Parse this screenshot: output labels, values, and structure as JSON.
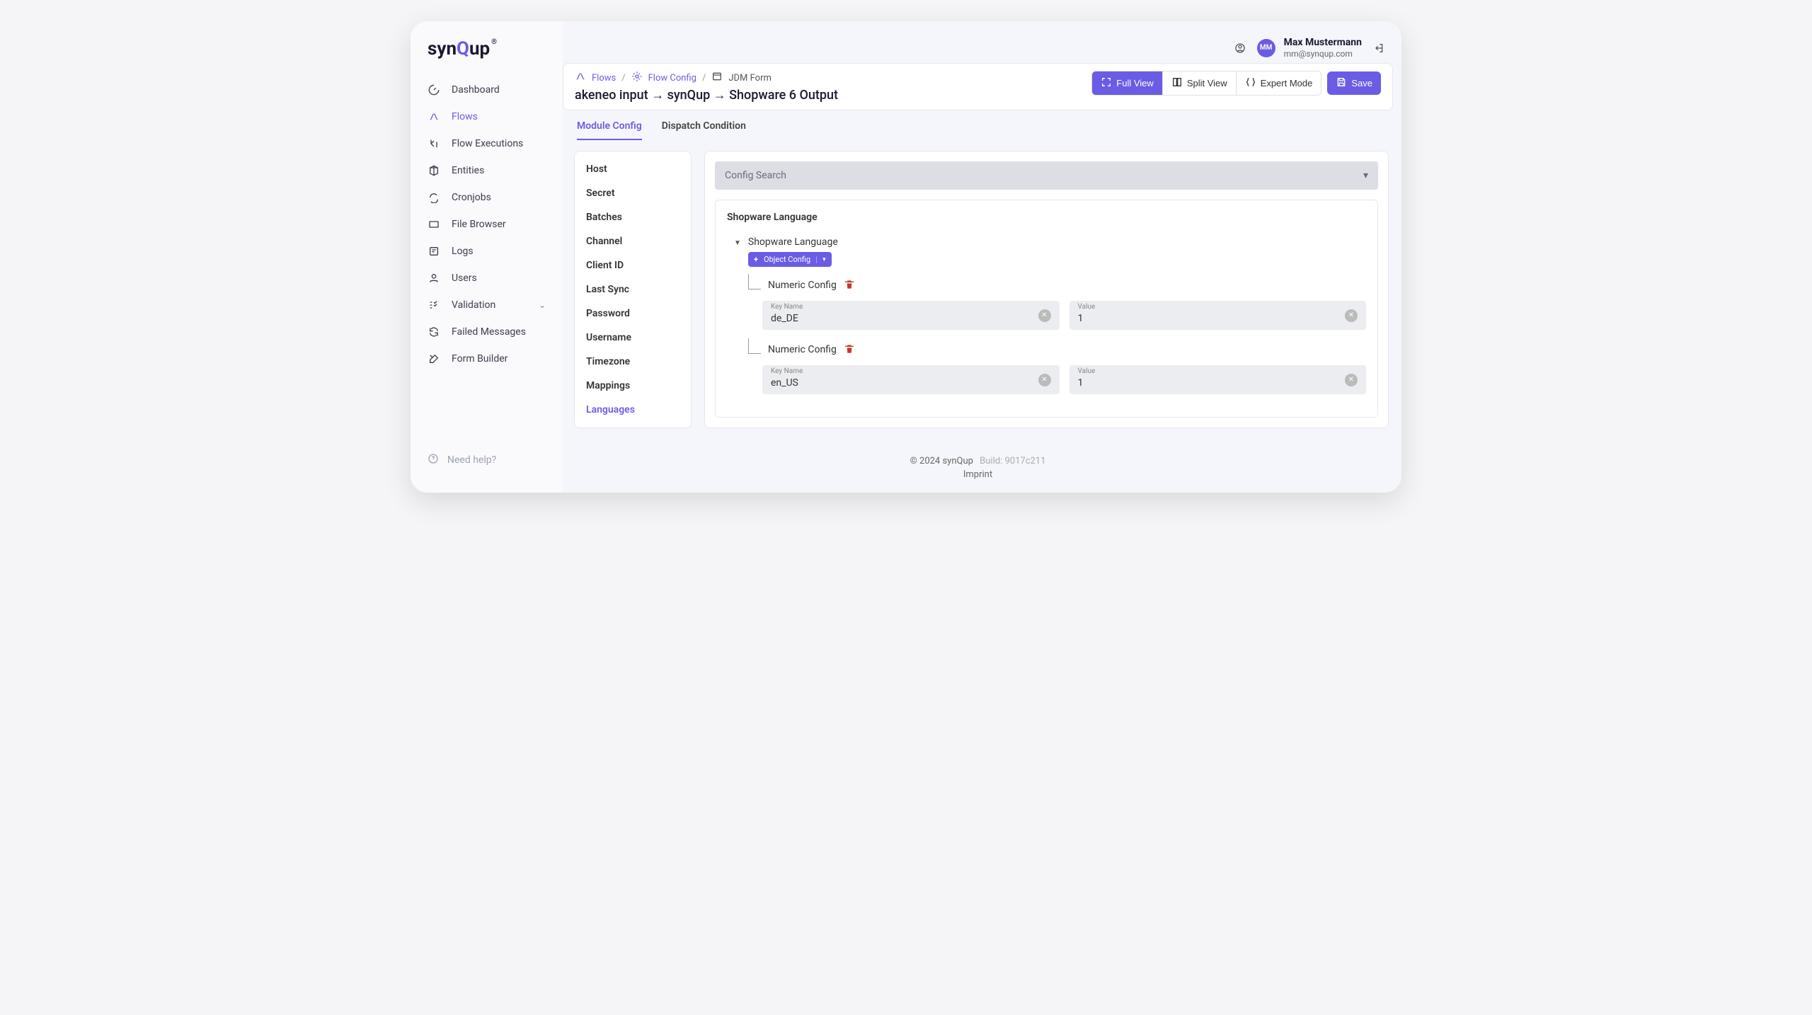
{
  "brand": {
    "text_a": "syn",
    "text_q": "Q",
    "text_b": "up",
    "reg": "®"
  },
  "user": {
    "initials": "MM",
    "name": "Max Mustermann",
    "email": "mm@synqup.com"
  },
  "sidebar": {
    "items": [
      {
        "label": "Dashboard"
      },
      {
        "label": "Flows"
      },
      {
        "label": "Flow Executions"
      },
      {
        "label": "Entities"
      },
      {
        "label": "Cronjobs"
      },
      {
        "label": "File Browser"
      },
      {
        "label": "Logs"
      },
      {
        "label": "Users"
      },
      {
        "label": "Validation"
      },
      {
        "label": "Failed Messages"
      },
      {
        "label": "Form Builder"
      }
    ],
    "help": "Need help?"
  },
  "breadcrumb": {
    "a": "Flows",
    "b": "Flow Config",
    "c": "JDM Form"
  },
  "page_title": "akeneo input → synQup → Shopware 6 Output",
  "header_buttons": {
    "full_view": "Full View",
    "split_view": "Split View",
    "expert_mode": "Expert Mode",
    "save": "Save"
  },
  "tabs": {
    "module_config": "Module Config",
    "dispatch_condition": "Dispatch Condition"
  },
  "config_nav": [
    "Host",
    "Secret",
    "Batches",
    "Channel",
    "Client ID",
    "Last Sync",
    "Password",
    "Username",
    "Timezone",
    "Mappings",
    "Languages"
  ],
  "search_placeholder": "Config Search",
  "section": {
    "title": "Shopware Language",
    "tree_title": "Shopware Language",
    "chip_label": "Object Config",
    "numeric_label": "Numeric Config",
    "fields": {
      "key_label": "Key Name",
      "value_label": "Value",
      "row1": {
        "key": "de_DE",
        "value": "1"
      },
      "row2": {
        "key": "en_US",
        "value": "1"
      }
    }
  },
  "footer": {
    "copyright": "© 2024 synQup",
    "build_prefix": "Build:",
    "build": "9017c211",
    "imprint": "Imprint"
  }
}
